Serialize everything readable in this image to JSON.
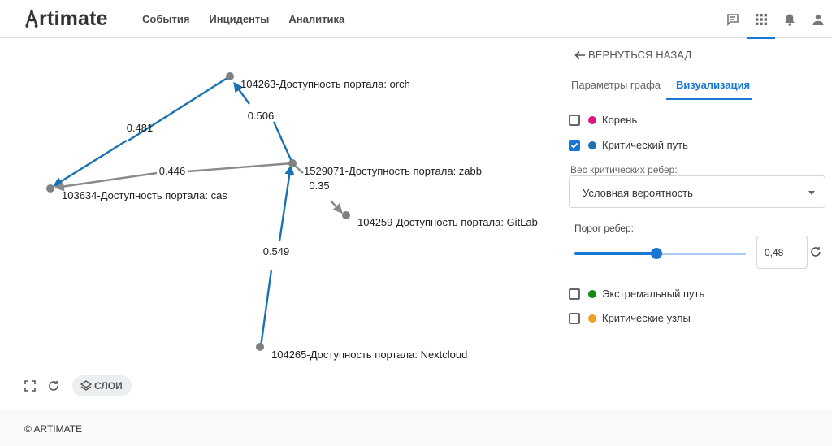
{
  "header": {
    "logo_text": "rtimate",
    "nav": [
      {
        "label": "События"
      },
      {
        "label": "Инциденты"
      },
      {
        "label": "Аналитика"
      }
    ],
    "icons": [
      "chat-icon",
      "apps-grid-icon",
      "bell-icon",
      "user-icon"
    ],
    "active_icon": "apps-grid-icon"
  },
  "graph": {
    "nodes": [
      {
        "label": "104263-Доступность портала: orch"
      },
      {
        "label": "103634-Доступность портала: cas"
      },
      {
        "label": "1529071-Доступность портала: zabb"
      },
      {
        "label": "104259-Доступность портала: GitLab"
      },
      {
        "label": "104265-Доступность портала: Nextcloud"
      }
    ],
    "edges": [
      {
        "from": "104263-Доступность портала: orch",
        "to": "103634-Доступность портала: cas",
        "weight": "0.481",
        "critical": true
      },
      {
        "from": "1529071-Доступность портала: zabb",
        "to": "104263-Доступность портала: orch",
        "weight": "0.506",
        "critical": true
      },
      {
        "from": "1529071-Доступность портала: zabb",
        "to": "103634-Доступность портала: cas",
        "weight": "0.446",
        "critical": false
      },
      {
        "from": "1529071-Доступность портала: zabb",
        "to": "104259-Доступность портала: GitLab",
        "weight": "0.35",
        "critical": false
      },
      {
        "from": "104265-Доступность портала: Nextcloud",
        "to": "1529071-Доступность портала: zabb",
        "weight": "0.549",
        "critical": true
      }
    ],
    "colors": {
      "critical_edge": "#1a73b0",
      "normal_edge": "#8a8a8a",
      "node": "#808080"
    }
  },
  "toolbar": {
    "fullscreen_icon": "fullscreen-icon",
    "refresh_icon": "refresh-icon",
    "layers_label": "СЛОИ"
  },
  "panel": {
    "back_label": "ВЕРНУТЬСЯ НАЗАД",
    "tabs": [
      {
        "label": "Параметры графа",
        "active": false
      },
      {
        "label": "Визуализация",
        "active": true
      }
    ],
    "options_top": [
      {
        "label": "Корень",
        "checked": false,
        "color": "#e0157a"
      },
      {
        "label": "Критический путь",
        "checked": true,
        "color": "#1a73b0"
      }
    ],
    "weight_select": {
      "caption": "Вес критических ребер:",
      "value": "Условная вероятность"
    },
    "threshold": {
      "label": "Порог ребер:",
      "value": "0,48",
      "fraction": 0.48
    },
    "options_bottom": [
      {
        "label": "Экстремальный путь",
        "checked": false,
        "color": "#138a13"
      },
      {
        "label": "Критические узлы",
        "checked": false,
        "color": "#f0a020"
      }
    ]
  },
  "footer": {
    "copyright": "© ARTIMATE"
  },
  "accent_color": "#1976d2"
}
